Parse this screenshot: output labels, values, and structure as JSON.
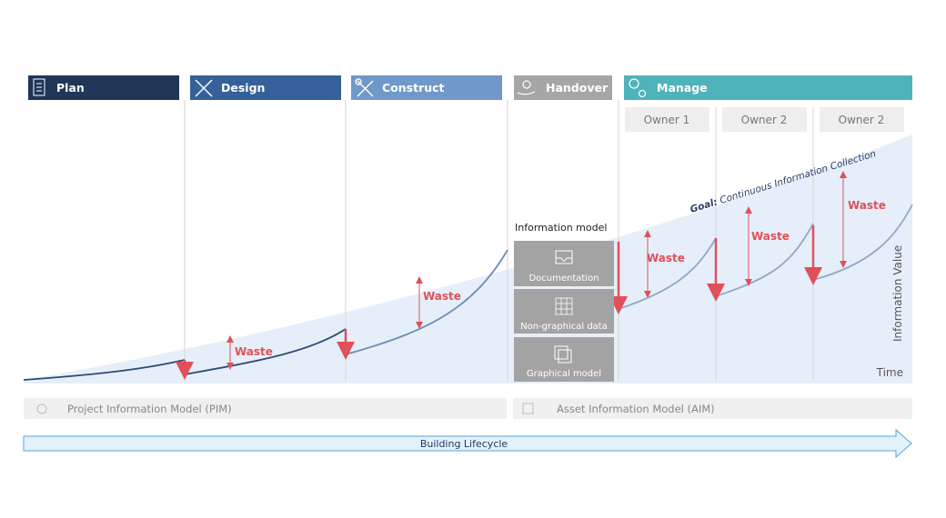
{
  "phases": [
    {
      "label": "Plan",
      "icon": "checklist-icon",
      "color": "#1f3657"
    },
    {
      "label": "Design",
      "icon": "pencil-ruler-icon",
      "color": "#35609a"
    },
    {
      "label": "Construct",
      "icon": "tools-icon",
      "color": "#7098c8"
    },
    {
      "label": "Handover",
      "icon": "hand-icon",
      "color": "#a6a6a6"
    },
    {
      "label": "Manage",
      "icon": "gears-icon",
      "color": "#4fb3bb"
    }
  ],
  "owners": [
    "Owner 1",
    "Owner 2",
    "Owner 2"
  ],
  "information_model": {
    "title": "Information model",
    "items": [
      {
        "label": "Documentation",
        "icon": "inbox-tray-icon"
      },
      {
        "label": "Non-graphical data",
        "icon": "grid-table-icon"
      },
      {
        "label": "Graphical model",
        "icon": "cube-model-icon"
      }
    ]
  },
  "waste_label": "Waste",
  "goal": {
    "prefix": "Goal:",
    "text": " Continuous Information Collection"
  },
  "axes": {
    "y": "Information Value",
    "x": "Time"
  },
  "models": {
    "pim": "Project Information Model (PIM)",
    "aim": "Asset Information Model (AIM)"
  },
  "lifecycle": "Building Lifecycle",
  "colors": {
    "waste": "#e0505a",
    "curve_dark": "#2a4a78",
    "curve_light": "#8fa9c9",
    "area": "#e6eff9"
  }
}
